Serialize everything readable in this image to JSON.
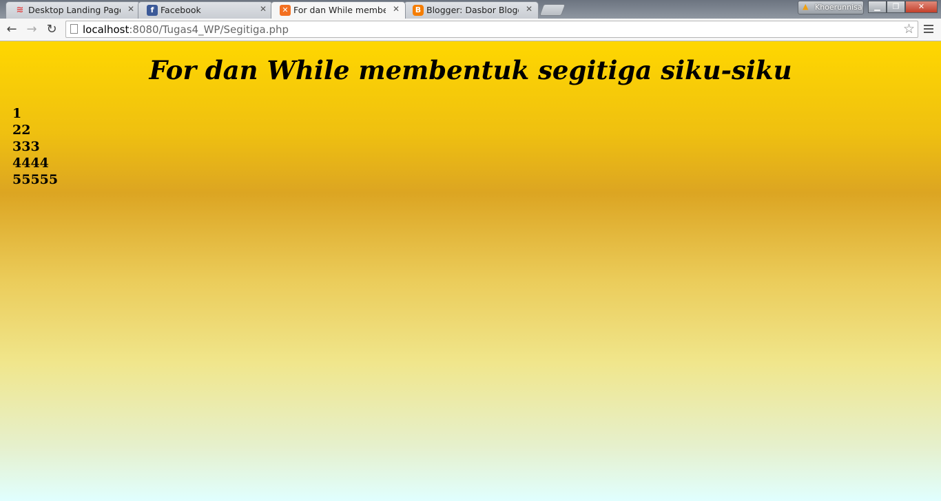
{
  "browser": {
    "tabs": [
      {
        "title": "Desktop Landing Page",
        "icon": "wifi-icon",
        "active": false
      },
      {
        "title": "Facebook",
        "icon": "facebook-icon",
        "active": false
      },
      {
        "title": "For dan While membentuk",
        "icon": "xampp-icon",
        "active": true
      },
      {
        "title": "Blogger: Dasbor Blogger",
        "icon": "blogger-icon",
        "active": false
      }
    ],
    "close_glyph": "✕",
    "profile_name": "Khoerunnisa",
    "address": {
      "host": "localhost",
      "path": ":8080/Tugas4_WP/Segitiga.php"
    }
  },
  "page": {
    "heading": "For dan While membentuk segitiga siku-siku",
    "rows": [
      "1",
      "22",
      "333",
      "4444",
      "55555"
    ]
  },
  "colors": {
    "gradient_top": "#ffd700",
    "gradient_mid": "#dca522",
    "gradient_bottom": "#e0ffff",
    "text": "#000000"
  }
}
